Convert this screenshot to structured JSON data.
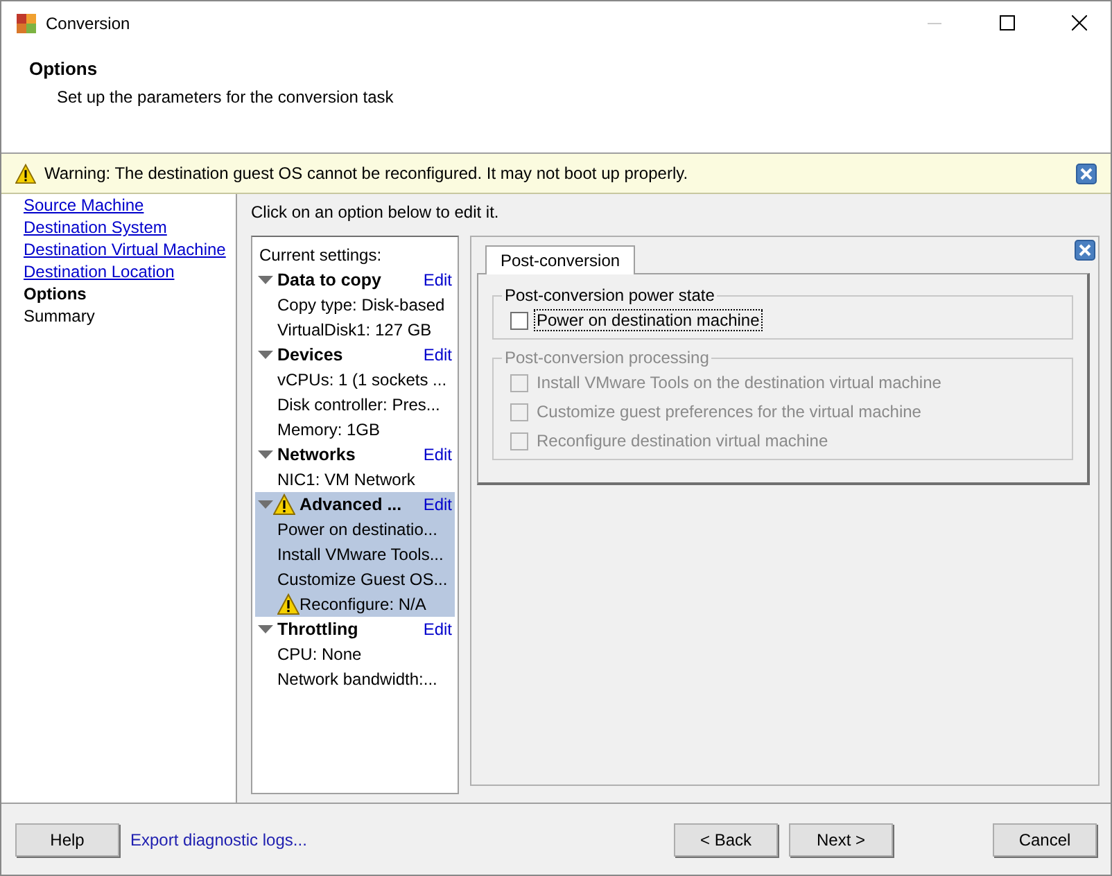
{
  "window": {
    "title": "Conversion"
  },
  "header": {
    "title": "Options",
    "subtitle": "Set up the parameters for the conversion task"
  },
  "warning": {
    "text": "Warning: The destination guest OS cannot be reconfigured. It may not boot up properly."
  },
  "nav": [
    {
      "label": "Source Machine",
      "kind": "link",
      "selected": false
    },
    {
      "label": "Destination System",
      "kind": "link",
      "selected": false
    },
    {
      "label": "Destination Virtual Machine",
      "kind": "link",
      "selected": false
    },
    {
      "label": "Destination Location",
      "kind": "link",
      "selected": false
    },
    {
      "label": "Options",
      "kind": "step",
      "selected": true
    },
    {
      "label": "Summary",
      "kind": "step",
      "selected": false
    }
  ],
  "instruction": "Click on an option below to edit it.",
  "settings": {
    "heading": "Current settings:",
    "groups": [
      {
        "title": "Data to copy",
        "edit": "Edit",
        "expanded": true,
        "selected": false,
        "warning": false,
        "items": [
          {
            "text": "Copy type: Disk-based",
            "warning": false
          },
          {
            "text": "VirtualDisk1: 127 GB",
            "warning": false
          }
        ]
      },
      {
        "title": "Devices",
        "edit": "Edit",
        "expanded": true,
        "selected": false,
        "warning": false,
        "items": [
          {
            "text": "vCPUs: 1 (1 sockets ...",
            "warning": false
          },
          {
            "text": "Disk controller: Pres...",
            "warning": false
          },
          {
            "text": "Memory: 1GB",
            "warning": false
          }
        ]
      },
      {
        "title": "Networks",
        "edit": "Edit",
        "expanded": true,
        "selected": false,
        "warning": false,
        "items": [
          {
            "text": "NIC1: VM Network",
            "warning": false
          }
        ]
      },
      {
        "title": "Advanced ...",
        "edit": "Edit",
        "expanded": true,
        "selected": true,
        "warning": true,
        "items": [
          {
            "text": "Power on destinatio...",
            "warning": false
          },
          {
            "text": "Install VMware Tools...",
            "warning": false
          },
          {
            "text": "Customize Guest OS...",
            "warning": false
          },
          {
            "text": "Reconfigure: N/A",
            "warning": true
          }
        ]
      },
      {
        "title": "Throttling",
        "edit": "Edit",
        "expanded": true,
        "selected": false,
        "warning": false,
        "items": [
          {
            "text": "CPU: None",
            "warning": false
          },
          {
            "text": "Network bandwidth:...",
            "warning": false
          }
        ]
      }
    ]
  },
  "tabs": [
    {
      "label": "Post-conversion",
      "selected": true
    }
  ],
  "fieldsets": [
    {
      "legend": "Post-conversion power state",
      "disabled": false,
      "options": [
        {
          "label": "Power on destination machine",
          "checked": false,
          "focused": true
        }
      ]
    },
    {
      "legend": "Post-conversion processing",
      "disabled": true,
      "options": [
        {
          "label": "Install VMware Tools on the destination virtual machine",
          "checked": false,
          "focused": false
        },
        {
          "label": "Customize guest preferences for the virtual machine",
          "checked": false,
          "focused": false
        },
        {
          "label": "Reconfigure destination virtual machine",
          "checked": false,
          "focused": false
        }
      ]
    }
  ],
  "footer": {
    "help": "Help",
    "export": "Export diagnostic logs...",
    "back": "< Back",
    "next": "Next >",
    "cancel": "Cancel"
  }
}
